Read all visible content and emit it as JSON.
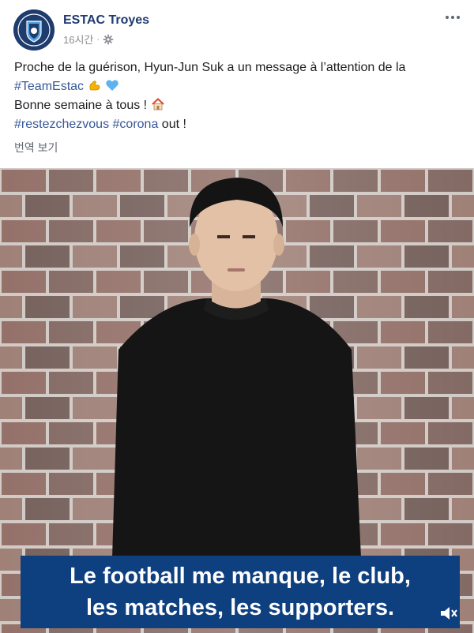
{
  "header": {
    "page_name": "ESTAC Troyes",
    "time": "16시간",
    "separator": "·",
    "more_icon": "more-dots-icon",
    "privacy_icon": "gear-icon"
  },
  "post": {
    "line1_text": "Proche de la guérison, Hyun-Jun Suk a un message à l’attention de la",
    "line2_hashtag": "#TeamEstac",
    "line2_emoji": "muscle-emoji heart-emoji",
    "line3_text": "Bonne semaine à tous !",
    "line3_emoji": "house-emoji",
    "line4_hashtag1": "#restezchezvous",
    "line4_hashtag2": "#corona",
    "line4_text": "out !",
    "translate_link": "번역 보기"
  },
  "video": {
    "caption_line1": "Le football me manque, le club,",
    "caption_line2": "les matches, les supporters.",
    "volume_icon": "volume-muted-icon"
  },
  "colors": {
    "brand_blue": "#1f3b6f",
    "hashtag": "#385898",
    "caption_bg": "#0e3f7f"
  }
}
